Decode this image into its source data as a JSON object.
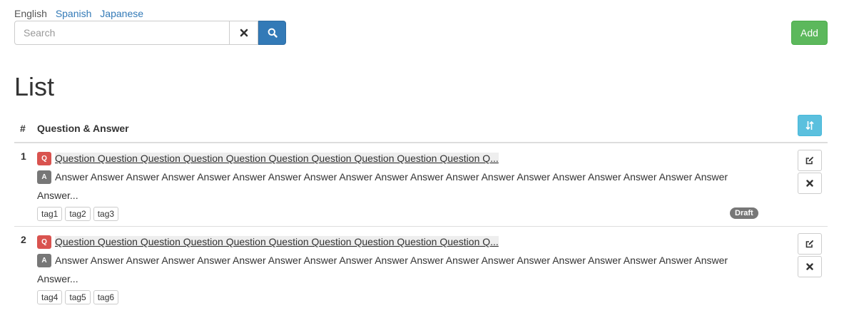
{
  "languages": {
    "current": "English",
    "links": [
      "Spanish",
      "Japanese"
    ]
  },
  "search": {
    "placeholder": "Search",
    "value": ""
  },
  "toolbar": {
    "add_label": "Add"
  },
  "page": {
    "title": "List"
  },
  "table": {
    "headers": {
      "num": "#",
      "qa": "Question & Answer"
    },
    "rows": [
      {
        "num": "1",
        "q_label": "Q",
        "question": "Question Question Question Question Question Question Question Question Question Question Q...",
        "a_label": "A",
        "answer_line1": "Answer Answer Answer Answer Answer Answer Answer Answer Answer Answer Answer Answer Answer Answer Answer Answer Answer Answer Answer",
        "answer_line2": "Answer...",
        "tags": [
          "tag1",
          "tag2",
          "tag3"
        ],
        "status": "Draft"
      },
      {
        "num": "2",
        "q_label": "Q",
        "question": "Question Question Question Question Question Question Question Question Question Question Q...",
        "a_label": "A",
        "answer_line1": "Answer Answer Answer Answer Answer Answer Answer Answer Answer Answer Answer Answer Answer Answer Answer Answer Answer Answer Answer",
        "answer_line2": "Answer...",
        "tags": [
          "tag4",
          "tag5",
          "tag6"
        ]
      }
    ]
  },
  "icons": {
    "clear": "times-icon",
    "search": "search-icon",
    "sort": "sort-icon",
    "edit": "edit-icon",
    "delete": "times-icon"
  },
  "colors": {
    "primary": "#337ab7",
    "success": "#5cb85c",
    "info": "#5bc0de",
    "danger": "#d9534f",
    "default_label": "#777777"
  }
}
